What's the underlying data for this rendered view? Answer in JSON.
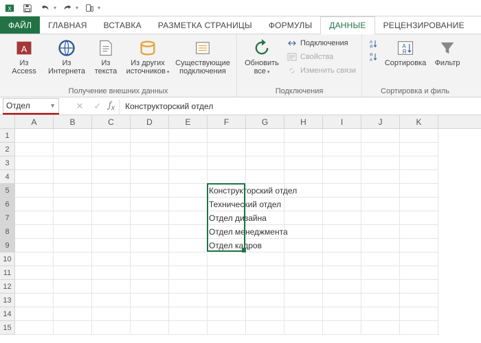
{
  "titlebar": {
    "icons": [
      "excel",
      "save",
      "undo",
      "redo",
      "touch"
    ]
  },
  "tabs": {
    "file": "ФАЙЛ",
    "items": [
      "ГЛАВНАЯ",
      "ВСТАВКА",
      "РАЗМЕТКА СТРАНИЦЫ",
      "ФОРМУЛЫ",
      "ДАННЫЕ",
      "РЕЦЕНЗИРОВАНИЕ"
    ],
    "active_index": 4
  },
  "ribbon": {
    "group_ext": {
      "label": "Получение внешних данных",
      "btn_access": "Из\nAccess",
      "btn_web": "Из\nИнтернета",
      "btn_text": "Из\nтекста",
      "btn_other": "Из других\nисточников",
      "btn_existing": "Существующие\nподключения"
    },
    "group_conn": {
      "label": "Подключения",
      "btn_refresh": "Обновить\nвсе",
      "item_connections": "Подключения",
      "item_properties": "Свойства",
      "item_editlinks": "Изменить связи"
    },
    "group_sort": {
      "label": "Сортировка и филь",
      "btn_sort": "Сортировка",
      "btn_filter": "Фильтр"
    }
  },
  "formula_bar": {
    "name_box": "Отдел",
    "formula": "Конструкторский отдел"
  },
  "grid": {
    "columns": [
      "A",
      "B",
      "C",
      "D",
      "E",
      "F",
      "G",
      "H",
      "I",
      "J",
      "K"
    ],
    "row_count": 15,
    "selected_rows": [
      5,
      6,
      7,
      8,
      9
    ],
    "selection": {
      "col": "F",
      "row_start": 5,
      "row_end": 9
    },
    "data": {
      "F5": "Конструкторский отдел",
      "F6": "Технический отдел",
      "F7": "Отдел дизайна",
      "F8": "Отдел менеджмента",
      "F9": "Отдел кадров"
    }
  }
}
